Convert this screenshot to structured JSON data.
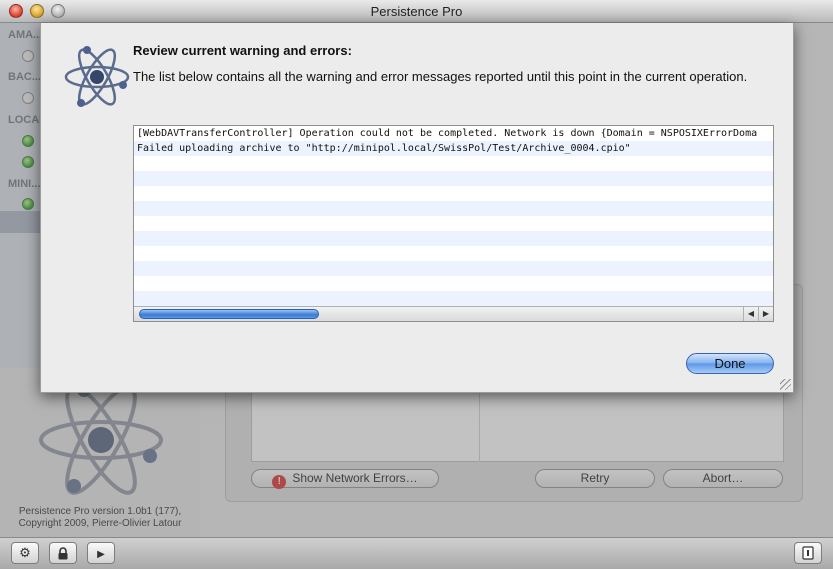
{
  "window": {
    "title": "Persistence Pro"
  },
  "sidebar": {
    "sections": [
      {
        "label": "AMA..."
      },
      {
        "label": "BAC..."
      },
      {
        "label": "LOCAL..."
      },
      {
        "label": "MINI..."
      }
    ],
    "version_line1": "Persistence Pro version 1.0b1 (177),",
    "version_line2": "Copyright 2009, Pierre-Olivier Latour"
  },
  "main": {
    "show_network_errors_label": "Show Network Errors…",
    "retry_label": "Retry",
    "abort_label": "Abort…"
  },
  "sheet": {
    "heading": "Review current warning and errors:",
    "description": "The list below contains all the warning and error messages reported until this point in the current operation.",
    "log_lines": [
      "[WebDAVTransferController] Operation could not be completed. Network is down {Domain = NSPOSIXErrorDoma",
      "Failed uploading archive to \"http://minipol.local/SwissPol/Test/Archive_0004.cpio\""
    ],
    "done_label": "Done"
  },
  "icons": {
    "settings": "gear-icon",
    "lock": "lock-icon",
    "play": "play-icon",
    "error": "error-icon",
    "app_logo": "atom-logo-icon"
  },
  "colors": {
    "accent": "#5b97e8",
    "error": "#dd2222",
    "status_ok": "#25a015"
  }
}
